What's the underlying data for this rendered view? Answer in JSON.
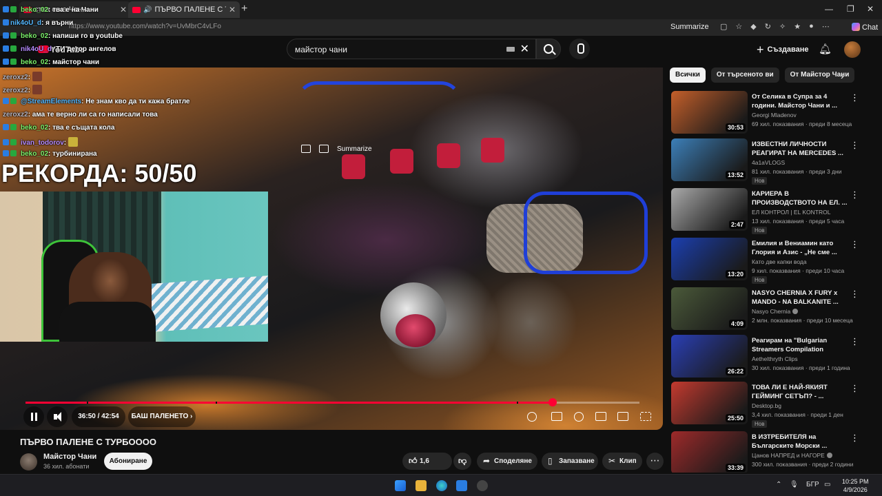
{
  "browser": {
    "tabs": [
      {
        "title": "ства е на Чани"
      },
      {
        "title": "ПЪРВО ПАЛЕНЕ С ТУРБОООО"
      }
    ],
    "url": "https://www.youtube.com/watch?v=UvMbrC4vLFo",
    "summarize_label": "Summarize",
    "chat_label": "Chat"
  },
  "youtube": {
    "logo_text": "YouTube",
    "search_value": "майстор чани",
    "create_label": "Създаване"
  },
  "stream_overlay": {
    "record_text": "РЕКОРДА: 50/50",
    "chat": [
      {
        "user": "beko_02",
        "color": "green",
        "message": ": тва е на Чани"
      },
      {
        "user": "nik4oU_d",
        "color": "blue",
        "message": ": я върни"
      },
      {
        "user": "beko_02",
        "color": "green",
        "message": ": напиши го в youtube"
      },
      {
        "user": "nik4oU_d",
        "color": "pur",
        "message": ": ТИ детор ангелов"
      },
      {
        "user": "beko_02",
        "color": "green",
        "message": ": майстор чани"
      },
      {
        "user": "zeroxz2",
        "color": "grey",
        "message": ":"
      },
      {
        "user": "zeroxz2",
        "color": "grey",
        "message": ":"
      },
      {
        "user": "@StreamElements",
        "color": "blue",
        "message": ": Не знам кво да ти кажа братле"
      },
      {
        "user": "zeroxz2",
        "color": "grey",
        "message": ": ама те верно ли са го написали това"
      },
      {
        "user": "beko_02",
        "color": "green",
        "message": ": тва е същата кола"
      },
      {
        "user": "ivan_todorov",
        "color": "pur",
        "message": ":"
      },
      {
        "user": "beko_02",
        "color": "green",
        "message": ": турбинирана"
      }
    ]
  },
  "player": {
    "summarize_label": "Summarize",
    "time": "36:50 / 42:54",
    "chapter": "БАШ ПАЛЕНЕТО",
    "progress": 0.8585,
    "chapter_markers": [
      0.1,
      0.31,
      0.8
    ]
  },
  "video": {
    "title": "ПЪРВО ПАЛЕНЕ С ТУРБОООО",
    "channel": "Майстор Чани",
    "subscribers": "36 хил. абонати",
    "subscribe_label": "Абониране",
    "likes": "1,6 хил.",
    "share_label": "Споделяне",
    "save_label": "Запазване",
    "clip_label": "Клип"
  },
  "sidebar": {
    "chips": [
      "Всички",
      "От търсеното ви",
      "От Майстор Чани"
    ],
    "recommendations": [
      {
        "title": "От Селика в Супра за 4 години. Майстор Чани и ...",
        "channel": "Georgi Mladenov",
        "meta": "69 хил. показвания · преди 8 месеца",
        "duration": "30:53",
        "new": false,
        "verified": false,
        "thumb": "#c45f2a"
      },
      {
        "title": "ИЗВЕСТНИ ЛИЧНОСТИ РЕАГИРАТ НА MERCEDES ...",
        "channel": "4a1aVLOGS",
        "meta": "81 хил. показвания · преди 3 дни",
        "duration": "13:52",
        "new": true,
        "verified": false,
        "thumb": "#3c7fb8"
      },
      {
        "title": "КАРИЕРА В ПРОИЗВОДСТВОТО НА ЕЛ. ...",
        "channel": "ЕЛ КОНТРОЛ | EL KONTROL",
        "meta": "13 хил. показвания · преди 5 часа",
        "duration": "2:47",
        "new": true,
        "verified": false,
        "thumb": "#a9a9a9"
      },
      {
        "title": "Емилия и Вениамин като Глория и Азис - „Не сме ...",
        "channel": "Като две капки вода",
        "meta": "9 хил. показвания · преди 10 часа",
        "duration": "13:20",
        "new": true,
        "verified": false,
        "thumb": "#1b3fb0"
      },
      {
        "title": "NASYO CHERNIA X FURY x MANDO - NA BALKANITE ...",
        "channel": "Nasyo Chernia",
        "meta": "2 млн. показвания · преди 10 месеца",
        "duration": "4:09",
        "new": false,
        "verified": true,
        "thumb": "#4b5a3a"
      },
      {
        "title": "Реагирам на \"Bulgarian Streamers Compilation Reborn...",
        "channel": "Aethelthryth Clips",
        "meta": "30 хил. показвания · преди 1 година",
        "duration": "26:22",
        "new": false,
        "verified": false,
        "thumb": "#2a3fb5"
      },
      {
        "title": "ТОВА ЛИ Е НАЙ-ЯКИЯТ ГЕЙМИНГ СЕТЪП? - ...",
        "channel": "Desktop.bg",
        "meta": "3,4 хил. показвания · преди 1 ден",
        "duration": "25:50",
        "new": true,
        "verified": false,
        "thumb": "#c43a2f"
      },
      {
        "title": "В ИЗТРЕБИТЕЛЯ на Българските Морски ...",
        "channel": "Цанов НАПРЕД и НАГОРЕ",
        "meta": "300 хил. показвания · преди 2 години",
        "duration": "33:39",
        "new": false,
        "verified": true,
        "thumb": "#9e2a2a"
      }
    ]
  },
  "taskbar": {
    "language": "БГР",
    "time": "10:25 PM",
    "date": "4/9/2026"
  }
}
